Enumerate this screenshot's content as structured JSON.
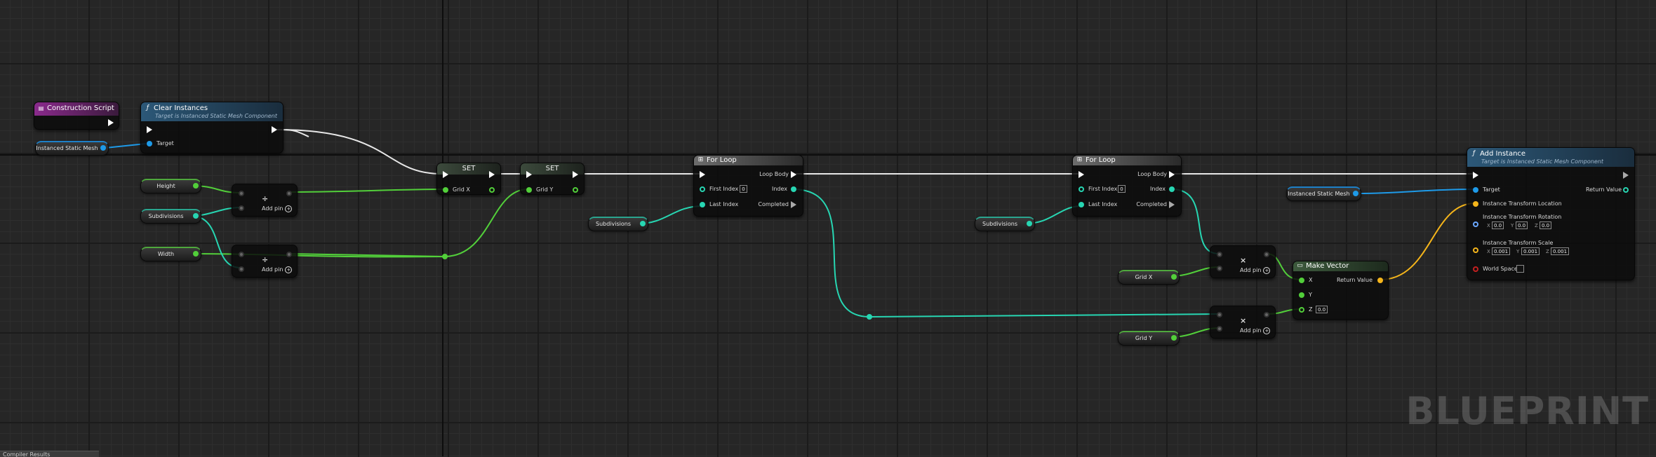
{
  "watermark": "BLUEPRINT",
  "bottom_tab": "Compiler Results",
  "nodes": {
    "construction_script": {
      "title": "Construction Script"
    },
    "clear_instances": {
      "title": "Clear Instances",
      "subtitle": "Target is Instanced Static Mesh Component",
      "target": "Target"
    },
    "set1": {
      "title": "SET",
      "pin": "Grid X"
    },
    "set2": {
      "title": "SET",
      "pin": "Grid Y"
    },
    "div1": {
      "op": "÷",
      "add_pin": "Add pin"
    },
    "div2": {
      "op": "÷",
      "add_pin": "Add pin"
    },
    "forloop1": {
      "title": "For Loop",
      "first_index": "First Index",
      "first_index_value": "0",
      "last_index": "Last Index",
      "loop_body": "Loop Body",
      "index": "Index",
      "completed": "Completed"
    },
    "forloop2": {
      "title": "For Loop",
      "first_index": "First Index",
      "first_index_value": "0",
      "last_index": "Last Index",
      "loop_body": "Loop Body",
      "index": "Index",
      "completed": "Completed"
    },
    "mul1": {
      "op": "×",
      "add_pin": "Add pin"
    },
    "mul2": {
      "op": "×",
      "add_pin": "Add pin"
    },
    "make_vector": {
      "title": "Make Vector",
      "x": "X",
      "y": "Y",
      "z": "Z",
      "z_value": "0.0",
      "return_value": "Return Value"
    },
    "add_instance": {
      "title": "Add Instance",
      "subtitle": "Target is Instanced Static Mesh Component",
      "target": "Target",
      "return_value": "Return Value",
      "location": "Instance Transform Location",
      "rotation": "Instance Transform Rotation",
      "rot_x": "0.0",
      "rot_y": "0.0",
      "rot_z": "0.0",
      "scale": "Instance Transform Scale",
      "scale_x": "0.001",
      "scale_y": "0.001",
      "scale_z": "0.001",
      "world_space": "World Space",
      "axis_x": "X",
      "axis_y": "Y",
      "axis_z": "Z"
    }
  },
  "variables": {
    "ism1": "Instanced Static Mesh",
    "height": "Height",
    "subdivisions1": "Subdivisions",
    "width": "Width",
    "subdivisions2": "Subdivisions",
    "subdivisions3": "Subdivisions",
    "ism2": "Instanced Static Mesh",
    "gridx": "Grid X",
    "gridy": "Grid Y"
  },
  "colors": {
    "exec": "#ffffff",
    "float": "#52cf3a",
    "int": "#27d6b2",
    "object": "#1e9ae8",
    "vector": "#f5b51b"
  }
}
